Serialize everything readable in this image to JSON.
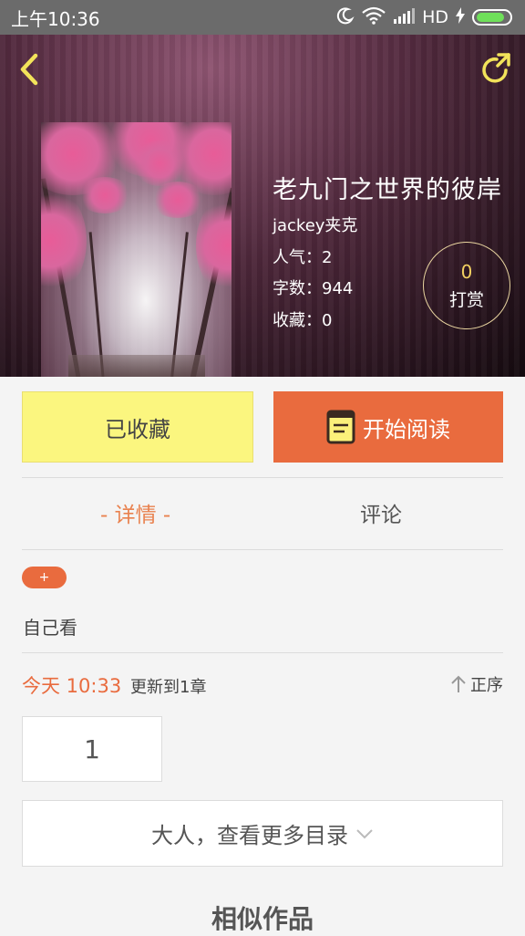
{
  "status_bar": {
    "time": "上午10:36",
    "network": "HD"
  },
  "book": {
    "title": "老九门之世界的彼岸",
    "author": "jackey夹克",
    "popularity": "人气：2",
    "word_count": "字数：944",
    "favorites": "收藏：0"
  },
  "reward": {
    "count": "0",
    "label": "打赏"
  },
  "actions": {
    "collect_label": "已收藏",
    "read_label": "开始阅读"
  },
  "tabs": {
    "detail": "- 详情 -",
    "comment": "评论"
  },
  "detail": {
    "tag_plus": "+",
    "intro": "自己看",
    "update_time": "今天 10:33",
    "update_text": "更新到1章",
    "sort_label": "正序",
    "chapter_number": "1",
    "more_catalog": "大人，查看更多目录",
    "similar_title": "相似作品"
  },
  "colors": {
    "accent": "#e96b3e",
    "collect_bg": "#fbf67f",
    "reward_gold": "#f2d061",
    "icon_yellow": "#f2e35a"
  },
  "icons": [
    "back-icon",
    "share-icon",
    "moon-icon",
    "wifi-icon",
    "signal-icon",
    "battery-icon",
    "book-icon",
    "arrow-up-icon",
    "chevron-down-icon"
  ]
}
